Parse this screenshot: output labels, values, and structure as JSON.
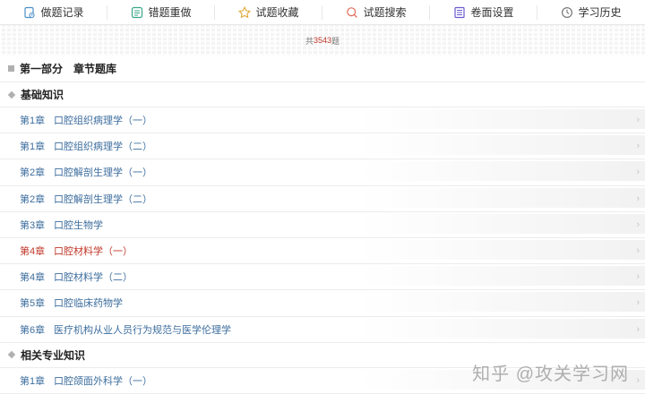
{
  "toolbar": {
    "items": [
      {
        "label": "做题记录",
        "icon": "record-icon"
      },
      {
        "label": "错题重做",
        "icon": "redo-icon"
      },
      {
        "label": "试题收藏",
        "icon": "star-icon"
      },
      {
        "label": "试题搜索",
        "icon": "search-icon"
      },
      {
        "label": "卷面设置",
        "icon": "settings-icon"
      },
      {
        "label": "学习历史",
        "icon": "history-icon"
      }
    ]
  },
  "count": {
    "prefix": "共",
    "number": "3543",
    "suffix": "题"
  },
  "part": {
    "title": "第一部分　章节题库"
  },
  "groups": [
    {
      "title": "基础知识",
      "chapters": [
        {
          "num": "第1章",
          "name": "口腔组织病理学（一）",
          "active": false
        },
        {
          "num": "第1章",
          "name": "口腔组织病理学（二）",
          "active": false
        },
        {
          "num": "第2章",
          "name": "口腔解剖生理学（一）",
          "active": false
        },
        {
          "num": "第2章",
          "name": "口腔解剖生理学（二）",
          "active": false
        },
        {
          "num": "第3章",
          "name": "口腔生物学",
          "active": false
        },
        {
          "num": "第4章",
          "name": "口腔材料学（一）",
          "active": true
        },
        {
          "num": "第4章",
          "name": "口腔材料学（二）",
          "active": false
        },
        {
          "num": "第5章",
          "name": "口腔临床药物学",
          "active": false
        },
        {
          "num": "第6章",
          "name": "医疗机构从业人员行为规范与医学伦理学",
          "active": false
        }
      ]
    },
    {
      "title": "相关专业知识",
      "chapters": [
        {
          "num": "第1章",
          "name": "口腔颌面外科学（一）",
          "active": false
        }
      ]
    }
  ],
  "watermark": "知乎 @攻关学习网",
  "colors": {
    "link": "#3d6e9e",
    "active": "#c0392b"
  }
}
